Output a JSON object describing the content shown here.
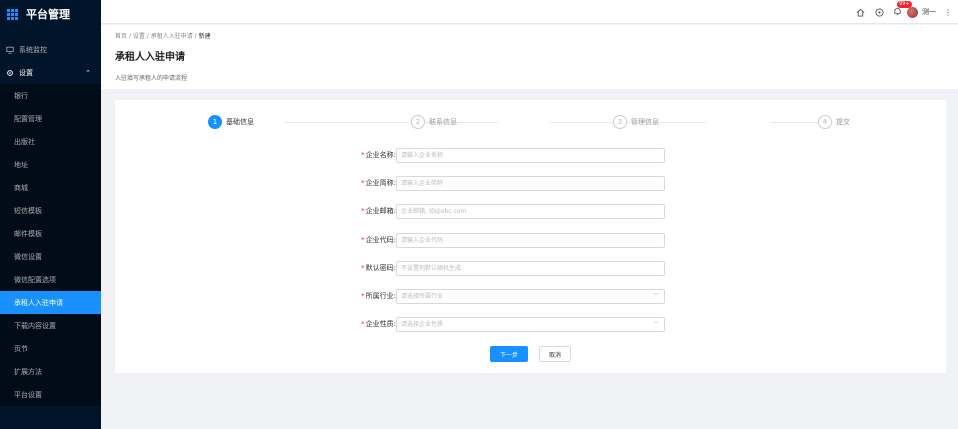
{
  "app": {
    "title": "平台管理"
  },
  "sidebar": {
    "items": [
      {
        "label": "系统监控",
        "icon": "monitor-icon"
      },
      {
        "label": "设置",
        "icon": "gear-icon"
      }
    ],
    "sub_items": [
      "银行",
      "配置管理",
      "出版社",
      "地址",
      "商城",
      "短信模板",
      "邮件模板",
      "微信设置",
      "微信配置选项",
      "承租人入驻申请",
      "下载内容设置",
      "页节",
      "扩展方法",
      "平台设置"
    ],
    "active_index": 9
  },
  "header": {
    "badge_count": "99+",
    "username": "测一"
  },
  "breadcrumb": {
    "items": [
      "首页",
      "设置",
      "承租人入驻申请"
    ],
    "current": "新建"
  },
  "page": {
    "title": "承租人入驻申请",
    "description": "入驻填写承租人的申请流程"
  },
  "steps": [
    {
      "num": "1",
      "label": "基础信息"
    },
    {
      "num": "2",
      "label": "联系信息"
    },
    {
      "num": "3",
      "label": "管理信息"
    },
    {
      "num": "4",
      "label": "提交"
    }
  ],
  "form": {
    "fields": [
      {
        "label": "企业名称:",
        "placeholder": "请输入企业名称"
      },
      {
        "label": "企业简称:",
        "placeholder": "请输入企业简称"
      },
      {
        "label": "企业邮箱:",
        "placeholder": "企业邮箱, 如@abc.com"
      },
      {
        "label": "企业代码:",
        "placeholder": "请输入企业代码"
      },
      {
        "label": "默认密码:",
        "placeholder": "不设置则默认随机生成"
      },
      {
        "label": "所属行业:",
        "placeholder": "请选择所属行业"
      },
      {
        "label": "企业性质:",
        "placeholder": "请选择企业性质"
      }
    ],
    "next_label": "下一步",
    "cancel_label": "取消"
  }
}
